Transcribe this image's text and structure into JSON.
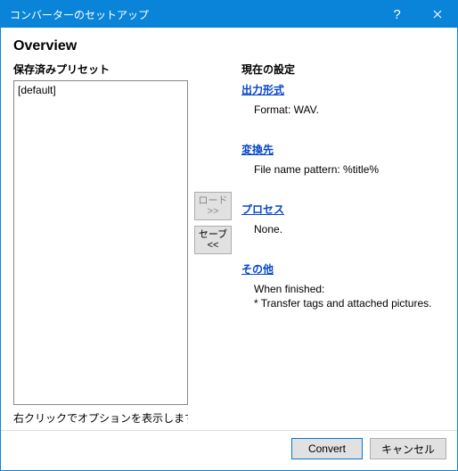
{
  "window": {
    "title": "コンバーターのセットアップ",
    "help_tooltip": "?",
    "close_tooltip": "×"
  },
  "overview_heading": "Overview",
  "presets": {
    "label": "保存済みプリセット",
    "items": [
      "[default]"
    ],
    "hint": "右クリックでオプションを表示します"
  },
  "mid_buttons": {
    "load_line1": "ロード",
    "load_line2": ">>",
    "save_line1": "セーブ",
    "save_line2": "<<"
  },
  "settings": {
    "label": "現在の設定",
    "sections": {
      "output": {
        "link": "出力形式",
        "body": "Format: WAV."
      },
      "destination": {
        "link": "変換先",
        "body": "File name pattern: %title%"
      },
      "process": {
        "link": "プロセス",
        "body": "None."
      },
      "other": {
        "link": "その他",
        "body_line1": "When finished:",
        "body_line2": "* Transfer tags and attached pictures."
      }
    }
  },
  "buttons": {
    "convert": "Convert",
    "cancel": "キャンセル"
  }
}
